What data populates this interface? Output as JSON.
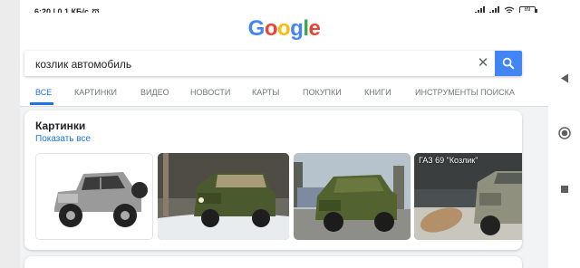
{
  "status_bar": {
    "time_info": "6:20 | 0,1 КБ/с",
    "battery": "89"
  },
  "logo": [
    "G",
    "o",
    "o",
    "g",
    "l",
    "e"
  ],
  "search": {
    "query": "козлик автомобиль"
  },
  "tabs": [
    {
      "label": "ВСЕ",
      "active": true
    },
    {
      "label": "КАРТИНКИ"
    },
    {
      "label": "ВИДЕО"
    },
    {
      "label": "НОВОСТИ"
    },
    {
      "label": "КАРТЫ"
    },
    {
      "label": "ПОКУПКИ"
    },
    {
      "label": "КНИГИ"
    },
    {
      "label": "ИНСТРУМЕНТЫ ПОИСКА"
    }
  ],
  "images_card": {
    "title": "Картинки",
    "show_all": "Показать все",
    "thumbnails": [
      {
        "alt": "silver-jeep-render"
      },
      {
        "alt": "green-uaz-winter"
      },
      {
        "alt": "green-gaz69-street"
      },
      {
        "alt": "gaz69-kozlik-photo",
        "caption": "ГАЗ 69 \"Козлик\""
      }
    ]
  },
  "colors": {
    "accent": "#1a73e8",
    "search_button": "#4285f4"
  },
  "nav_icons": [
    "back-icon",
    "home-icon",
    "recents-icon"
  ]
}
